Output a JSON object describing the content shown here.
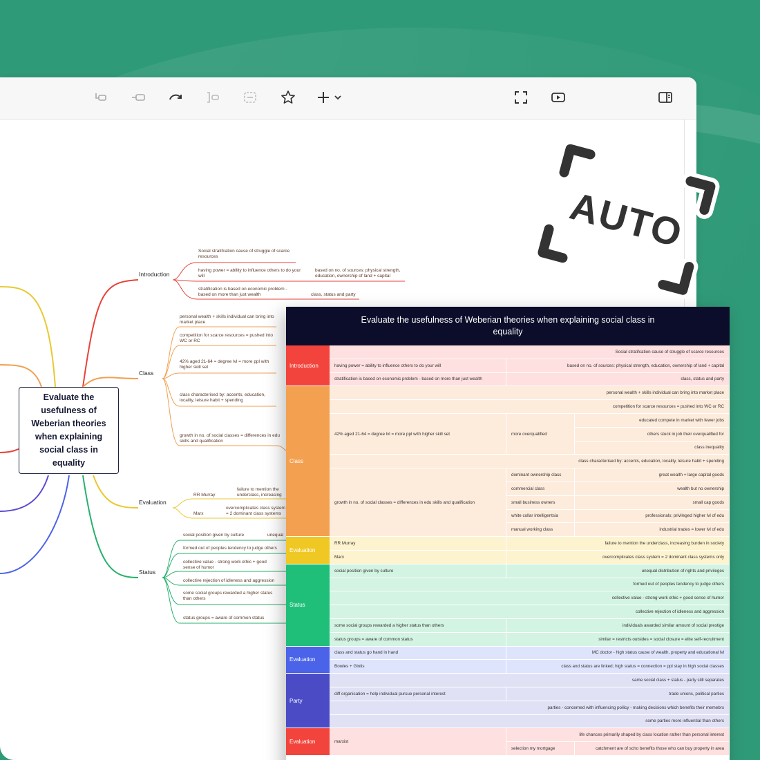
{
  "colors": {
    "background": "#2f9a78",
    "header": "#0b0d2a"
  },
  "toolbar": {
    "icons": [
      "insert-before-icon",
      "insert-sibling-icon",
      "redo-icon",
      "bracket-icon",
      "summary-icon",
      "star-icon",
      "add-icon",
      "chevron-down-icon",
      "fullscreen-icon",
      "play-icon",
      "sidebar-icon"
    ]
  },
  "auto_badge": {
    "label": "AUTO"
  },
  "mindmap": {
    "root": "Evaluate the usefulness of Weberian theories when explaining social class in equality",
    "branches": [
      {
        "label": "Introduction",
        "color": "#e8423b"
      },
      {
        "label": "Class",
        "color": "#f0a050"
      },
      {
        "label": "Evaluation",
        "color": "#e8c930"
      },
      {
        "label": "Status",
        "color": "#27b06e"
      }
    ],
    "intro_nodes": [
      "Social stratifcation  cause of struggle of scarce resources",
      "having power =  ability to influence others to do your will",
      "based on no. of sources:  physical strength, education, ownership of land + capital",
      "stratification is based on economic problem - based on more than just wealth",
      "class, status and party"
    ],
    "class_nodes": [
      "personal wealth + skills individual can bring into market place",
      "competition for scarce resources = pushed into WC or RC",
      "42% aged 21-64 = degree lvl = more ppl with higher skill set",
      "class characterised by: accents, education, locality, leisure habit + spending",
      "growth in no. of social classes =  differences in edu skills and qualification"
    ],
    "eval_nodes": [
      "RR Murray",
      "failure to mention the underclass, increasing burden in society",
      "Marx",
      "overcomplicates class system = 2 dominant class systems only"
    ],
    "status_nodes": [
      "social position given by culture",
      "unequal distribution of rights and privileges",
      "formed out of peoples tendency to judge others",
      "collective value - strong work ethic + good sense of humor",
      "collective rejection of idleness and aggression",
      "some social groups rewarded a higher status than others",
      "status groups = aware of common status"
    ]
  },
  "sheet": {
    "title": "Evaluate the usefulness of Weberian theories when explaining social class in equality",
    "sections": [
      {
        "label": "Introduction",
        "color": "#f2443c",
        "tint": "#fde0df"
      },
      {
        "label": "Class",
        "color": "#f3a150",
        "tint": "#fdebdc"
      },
      {
        "label": "Evaluation",
        "color": "#f0c824",
        "tint": "#fdf3cf"
      },
      {
        "label": "Status",
        "color": "#1fbf7a",
        "tint": "#d3f3e3"
      },
      {
        "label": "Evaluation",
        "color": "#4a63e8",
        "tint": "#dfe4fd"
      },
      {
        "label": "Party",
        "color": "#4b4bc6",
        "tint": "#e1e1f6"
      },
      {
        "label": "Evaluation",
        "color": "#f2443c",
        "tint": "#fde0df"
      }
    ],
    "rows": {
      "intro": [
        "Social stratifcation  cause of struggle of scarce resources",
        "having power =  ability to influence others to do your will",
        "based on no. of sources:  physical strength, education, ownership of land + capital",
        "stratification is based on economic problem - based on more than just wealth",
        "class, status and party"
      ],
      "class": [
        "personal wealth + skills individual can bring into market place",
        "competition for scarce resources = pushed into WC or RC",
        "42% aged 21-64 = degree lvl = more ppl with higher skill set",
        "more overqualified",
        "educated compete in market with fewer jobs",
        "others stuck in job their overqualified for",
        "class inequality",
        "class characterised by: accents, education, locality, leisure habit + spending",
        "growth in no. of social classes =  differences in edu skills and qualification",
        "dominant ownership class",
        "great wealth + large capital goods",
        "commercial class",
        "wealth but no ownership",
        "small business owners",
        "small cap goods",
        "white collar intelligentsia",
        "professionals; privileged higher lvl of edu",
        "manual working class",
        "industrial trades = lower lvl of edu"
      ],
      "eval1": [
        "RR Murray",
        "failure to mention the underclass, increasing burden in society",
        "Marx",
        "overcomplicates class system = 2 dominant class systems only"
      ],
      "status": [
        "social position given by culture",
        "unequal distribution of rights and privileges",
        "formed out of peoples tendency to judge others",
        "collective value - strong work ethic + good sense of humor",
        "collective rejection of idleness and aggression",
        "some social groups rewarded a higher status than others",
        "individuals awarded similar amount of social prestige",
        "status groups = aware of common status",
        "similar = restricts outsides = social closure = elite self-recruitment"
      ],
      "eval2": [
        "class and status go hand in hand",
        "MC doctor - high status cause of wealth, property and educational lvl",
        "Bowles + Gintis",
        "class and status are linked; high status = connection = ppl stay in high social classes"
      ],
      "party": [
        "same social class + status - party still separates",
        "diff organisation = help individual pursue personal interest",
        "trade unions,  political parties",
        "parties - concerned with influencing poilicy - making decisions which benefits their memebrs",
        "some parties more influential than others"
      ],
      "eval3": [
        "marxist",
        "life chances primarily shaped by class location  rather than personal interest",
        "selection my mortgage",
        "catchment are of scho benefits those who can buy property in area"
      ]
    }
  }
}
